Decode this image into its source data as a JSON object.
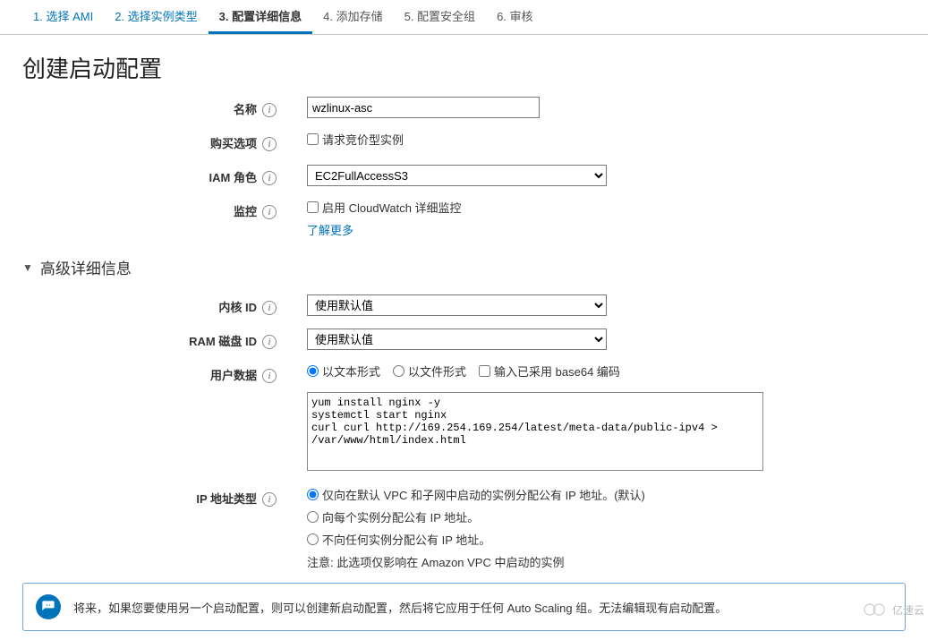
{
  "steps": {
    "s1": "1. 选择 AMI",
    "s2": "2. 选择实例类型",
    "s3": "3. 配置详细信息",
    "s4": "4. 添加存储",
    "s5": "5. 配置安全组",
    "s6": "6. 审核"
  },
  "page_title": "创建启动配置",
  "form": {
    "name_label": "名称",
    "name_value": "wzlinux-asc",
    "purchase_label": "购买选项",
    "purchase_checkbox": "请求竞价型实例",
    "iam_label": "IAM 角色",
    "iam_value": "EC2FullAccessS3",
    "monitor_label": "监控",
    "monitor_checkbox": "启用 CloudWatch 详细监控",
    "learn_more": "了解更多"
  },
  "advanced": {
    "header": "高级详细信息",
    "kernel_label": "内核 ID",
    "kernel_value": "使用默认值",
    "ram_label": "RAM 磁盘 ID",
    "ram_value": "使用默认值",
    "userdata_label": "用户数据",
    "ud_radio_text": "以文本形式",
    "ud_radio_file": "以文件形式",
    "ud_check_b64": "输入已采用 base64 编码",
    "userdata_value": "yum install nginx -y\nsystemctl start nginx\ncurl curl http://169.254.169.254/latest/meta-data/public-ipv4 > /var/www/html/index.html",
    "iptype_label": "IP 地址类型",
    "ip_radio1": "仅向在默认 VPC 和子网中启动的实例分配公有 IP 地址。(默认)",
    "ip_radio2": "向每个实例分配公有 IP 地址。",
    "ip_radio3": "不向任何实例分配公有 IP 地址。",
    "ip_note": "注意: 此选项仅影响在 Amazon VPC 中启动的实例"
  },
  "notice": "将来，如果您要使用另一个启动配置，则可以创建新启动配置，然后将它应用于任何 Auto Scaling 组。无法编辑现有启动配置。",
  "watermark": "亿速云"
}
